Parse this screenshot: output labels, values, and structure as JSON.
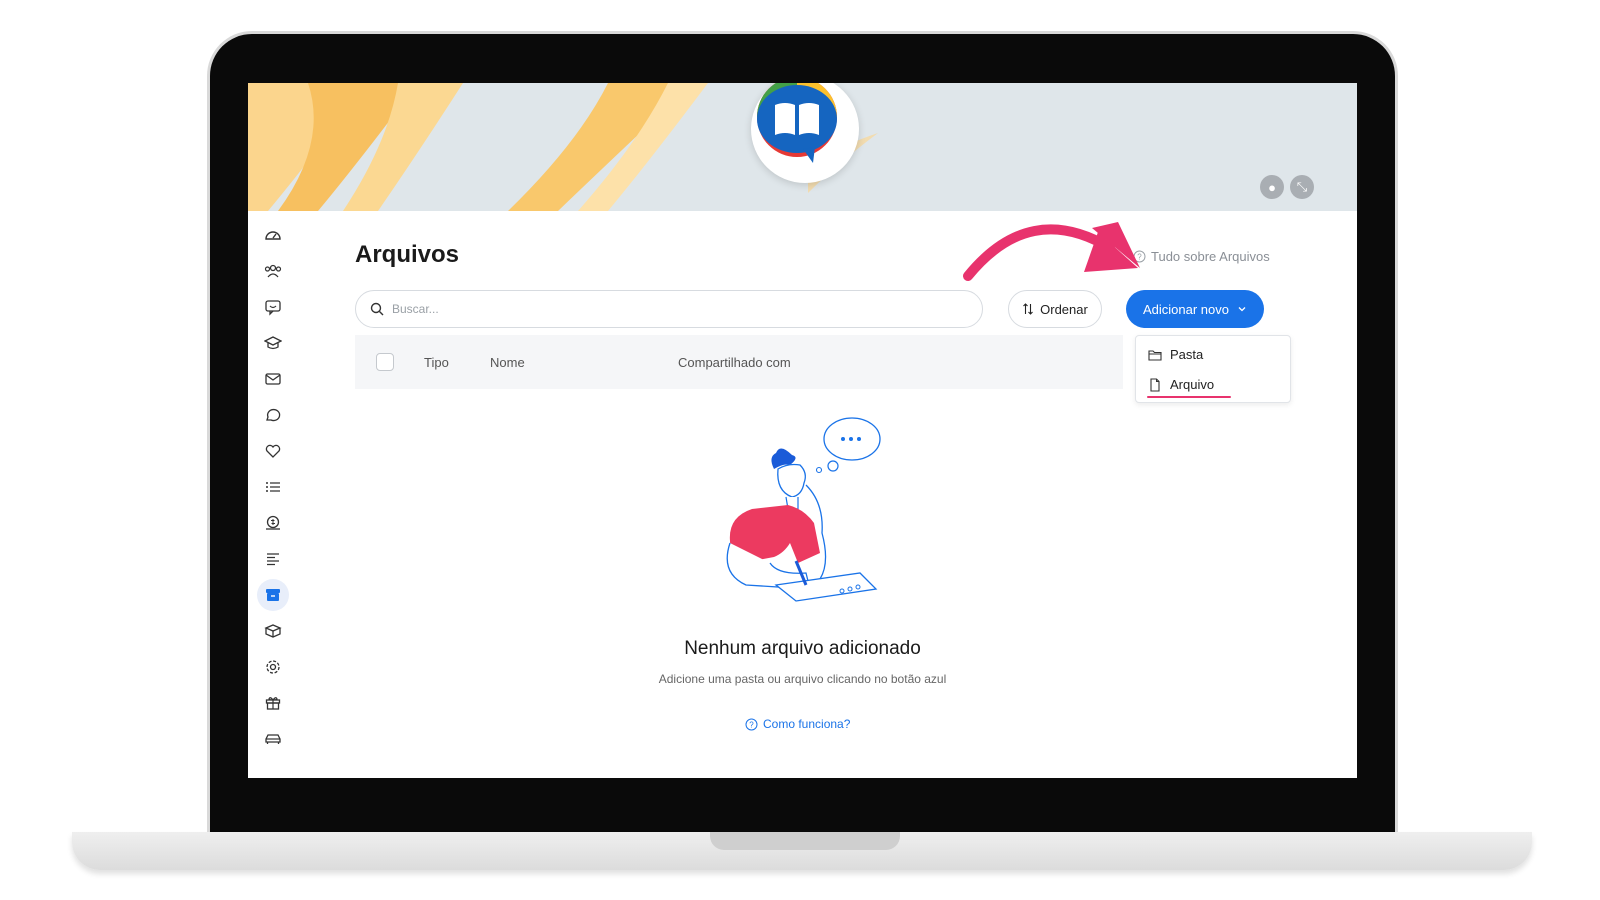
{
  "page": {
    "title": "Arquivos",
    "help_link": "Tudo sobre Arquivos"
  },
  "search": {
    "placeholder": "Buscar..."
  },
  "toolbar": {
    "sort_label": "Ordenar",
    "add_label": "Adicionar novo"
  },
  "table": {
    "columns": [
      "Tipo",
      "Nome",
      "Compartilhado com"
    ]
  },
  "dropdown": {
    "items": [
      {
        "label": "Pasta",
        "icon": "folder-icon"
      },
      {
        "label": "Arquivo",
        "icon": "file-icon"
      }
    ]
  },
  "empty_state": {
    "title": "Nenhum arquivo adicionado",
    "subtitle": "Adicione uma pasta ou arquivo clicando no botão azul",
    "how_link": "Como funciona?"
  },
  "sidebar": {
    "icons": [
      "dashboard-icon",
      "users-icon",
      "feedback-icon",
      "graduation-icon",
      "mail-icon",
      "chat-icon",
      "heart-icon",
      "list-icon",
      "money-icon",
      "text-lines-icon",
      "archive-icon",
      "gift-box-icon",
      "settings-icon",
      "gift-icon",
      "car-icon"
    ],
    "active_icon": "archive-icon"
  },
  "colors": {
    "accent": "#1a73e8",
    "annotation": "#e8336d",
    "banner_yellow": "#f8c36a"
  }
}
